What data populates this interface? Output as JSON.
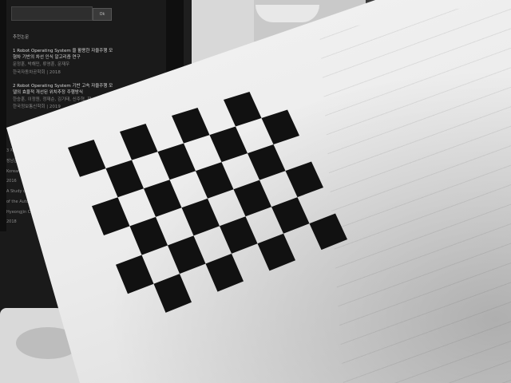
{
  "scene": {
    "monitor": {
      "search_button": "Ok",
      "section_heading": "추천논문",
      "items": [
        {
          "title": "1 Robot Operating System 을 활용한 자율주행 모형차 기반의 차선 인식 알고리즘 연구",
          "authors": "문정훈, 박해민, 류영훈, 문재우",
          "venue": "한국자동차공학회 | 2018"
        },
        {
          "title": "2 Robot Operating System 기반 고속 자율주행 모델의 효율적 개선된 위치추정 주행방식",
          "authors": "한승훈, 이정원, 정재순, 김기태, 신주혁, 함",
          "venue": "한국정보통신학회 | 2019"
        }
      ],
      "side_snippets": [
        "3 자율주",
        "장남균, 이",
        "Korean S",
        "2016",
        "A Study on t",
        "of the Autono",
        "Hyeongjin Cho, Ph",
        "2018"
      ]
    },
    "checkerboard": {
      "rows": 6,
      "cols": 8,
      "colors": {
        "dark": "#111111",
        "light": "#f2f2f2"
      }
    },
    "colors": {
      "paper": "#eeeeee",
      "background": "#2a2a2a",
      "monitor": "#0f0f0f"
    }
  }
}
